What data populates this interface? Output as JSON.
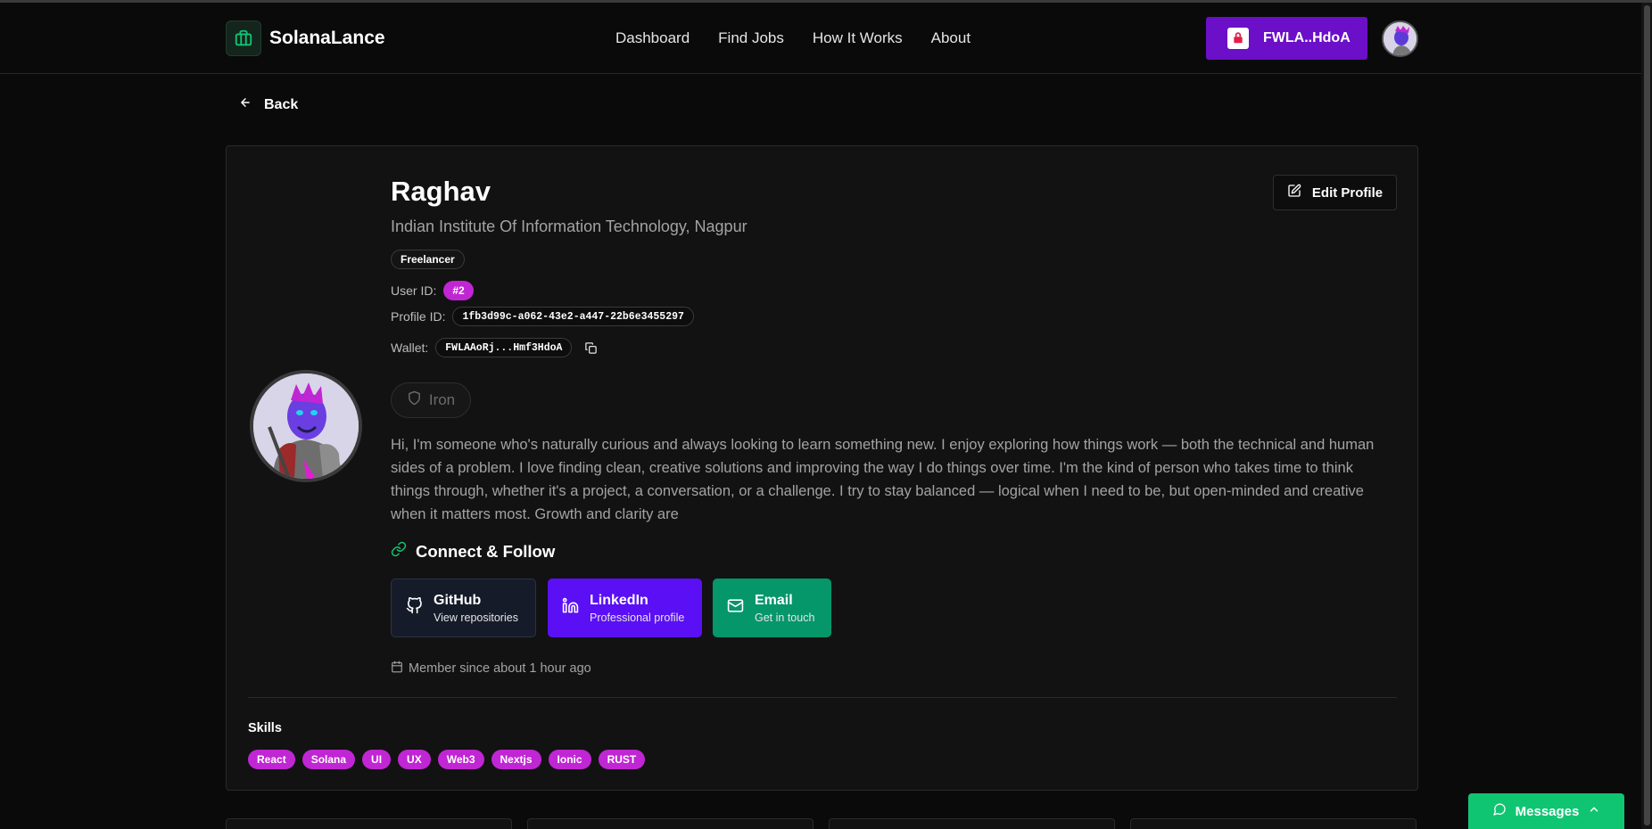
{
  "brand": {
    "name": "SolanaLance",
    "accent": "#10c572"
  },
  "nav": {
    "links": [
      "Dashboard",
      "Find Jobs",
      "How It Works",
      "About"
    ]
  },
  "wallet": {
    "label": "FWLA..HdoA",
    "color": "#6b0fc8"
  },
  "back": {
    "label": "Back"
  },
  "profile": {
    "name": "Raghav",
    "institute": "Indian Institute Of Information Technology, Nagpur",
    "role": "Freelancer",
    "user_id_label": "User ID:",
    "user_id": "#2",
    "profile_id_label": "Profile ID:",
    "profile_id": "1fb3d99c-a062-43e2-a447-22b6e3455297",
    "wallet_label": "Wallet:",
    "wallet": "FWLAAoRj...Hmf3HdoA",
    "rank": "Iron",
    "bio": "Hi, I'm someone who's naturally curious and always looking to learn something new. I enjoy exploring how things work — both the technical and human sides of a problem. I love finding clean, creative solutions and improving the way I do things over time. I'm the kind of person who takes time to think things through, whether it's a project, a conversation, or a challenge. I try to stay balanced — logical when I need to be, but open-minded and creative when it matters most. Growth and clarity are",
    "edit_label": "Edit Profile",
    "member_since": "Member since about 1 hour ago"
  },
  "connect": {
    "title": "Connect & Follow",
    "github": {
      "title": "GitHub",
      "subtitle": "View repositories"
    },
    "linkedin": {
      "title": "LinkedIn",
      "subtitle": "Professional profile"
    },
    "email": {
      "title": "Email",
      "subtitle": "Get in touch"
    }
  },
  "skills": {
    "title": "Skills",
    "items": [
      "React",
      "Solana",
      "UI",
      "UX",
      "Web3",
      "Nextjs",
      "Ionic",
      "RUST"
    ],
    "color": "#c026d3"
  },
  "messages": {
    "label": "Messages"
  }
}
